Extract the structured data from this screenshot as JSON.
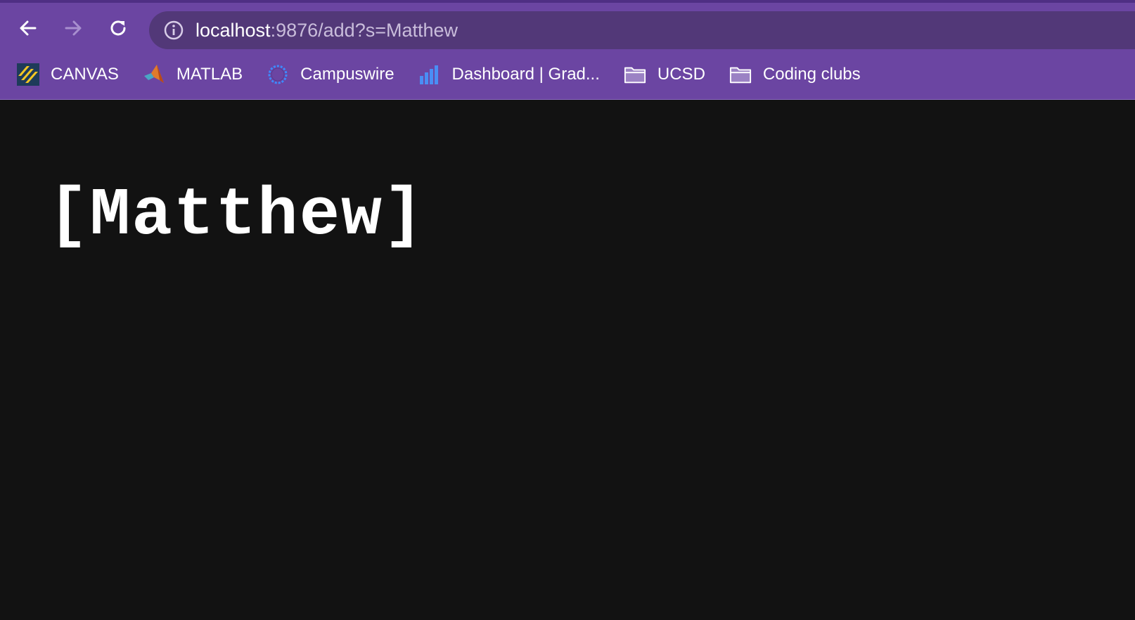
{
  "browser": {
    "address_bar": {
      "host": "localhost",
      "path": ":9876/add?s=Matthew"
    },
    "bookmarks": [
      {
        "label": "CANVAS",
        "icon": "canvas-icon"
      },
      {
        "label": "MATLAB",
        "icon": "matlab-icon"
      },
      {
        "label": "Campuswire",
        "icon": "campuswire-icon"
      },
      {
        "label": "Dashboard | Grad...",
        "icon": "bar-chart-icon"
      },
      {
        "label": "UCSD",
        "icon": "folder-icon"
      },
      {
        "label": "Coding clubs",
        "icon": "folder-icon"
      }
    ],
    "theme_colors": {
      "frame": "#6b45a2",
      "omnibox": "#523878",
      "page_background": "#121212"
    }
  },
  "page": {
    "output_text": "[Matthew]"
  }
}
